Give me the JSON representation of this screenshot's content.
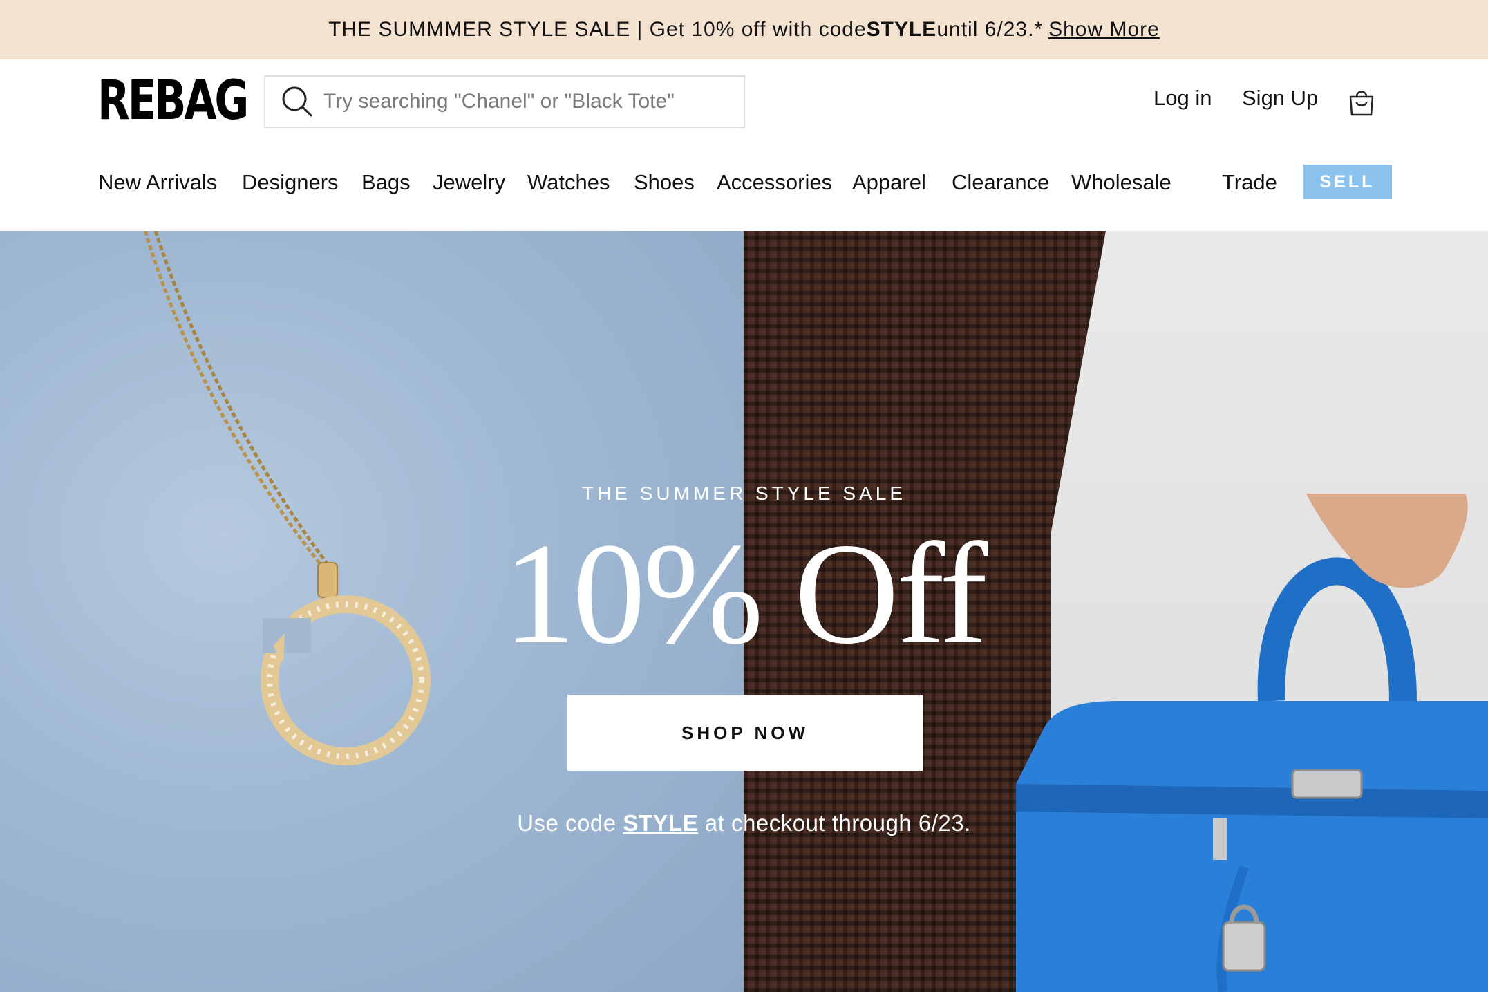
{
  "promo": {
    "text_before": "THE SUMMMER STYLE SALE | Get 10% off with code ",
    "code": "STYLE",
    "text_after": " until 6/23.*",
    "link": "Show More"
  },
  "header": {
    "logo": "REBAG",
    "search_placeholder": "Try searching \"Chanel\" or \"Black Tote\"",
    "login": "Log in",
    "signup": "Sign Up"
  },
  "nav": {
    "items": [
      "New Arrivals",
      "Designers",
      "Bags",
      "Jewelry",
      "Watches",
      "Shoes",
      "Accessories",
      "Apparel",
      "Clearance",
      "Wholesale",
      "Trade"
    ],
    "sell": "SELL"
  },
  "hero": {
    "kicker": "THE SUMMER STYLE SALE",
    "headline": "10% Off",
    "cta": "SHOP NOW",
    "sub_before": "Use code ",
    "sub_code": "STYLE",
    "sub_after": " at checkout through 6/23."
  },
  "colors": {
    "promo_bg": "#f5e3d2",
    "sell_bg": "#8cc3ee"
  }
}
